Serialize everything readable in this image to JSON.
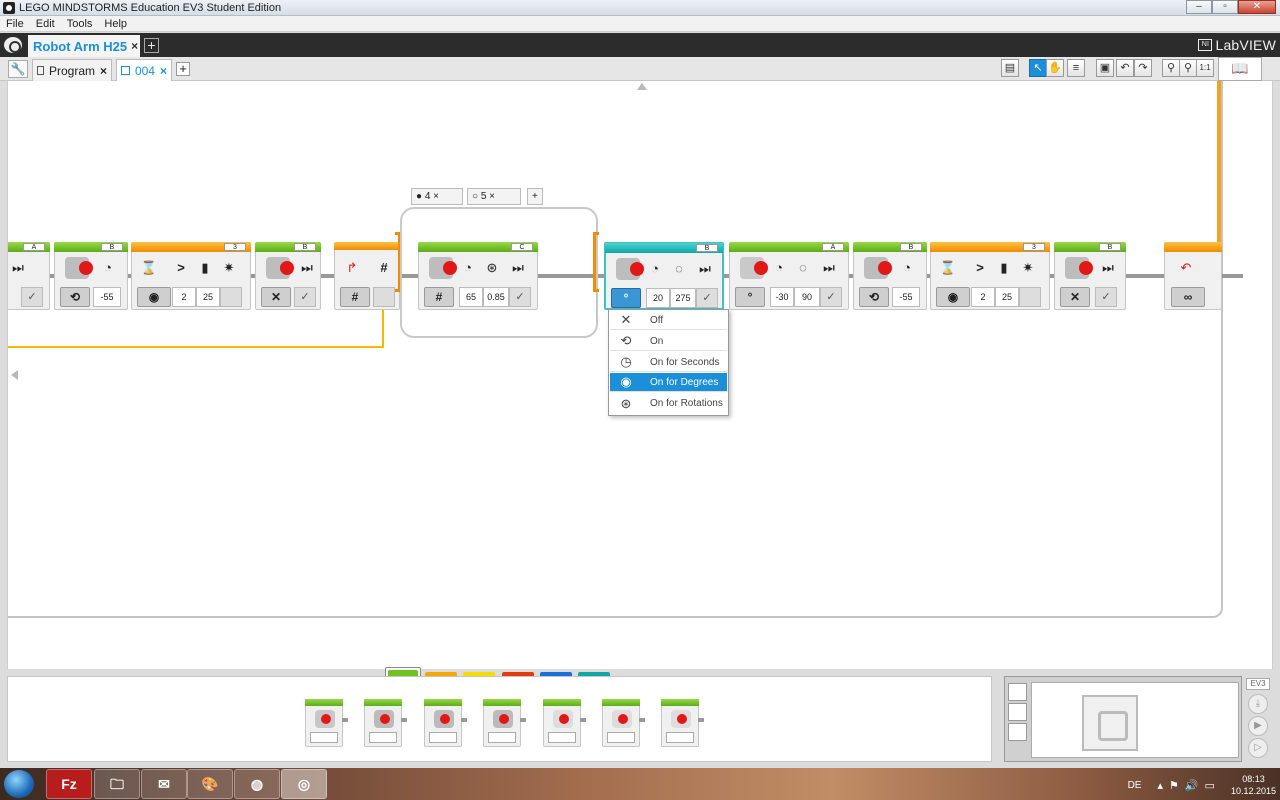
{
  "window": {
    "title": "LEGO MINDSTORMS Education EV3 Student Edition",
    "controls": [
      "–",
      "▫",
      "✕"
    ]
  },
  "menu": [
    "File",
    "Edit",
    "Tools",
    "Help"
  ],
  "project": {
    "name": "Robot Arm H25",
    "close": "×",
    "add": "+",
    "brand": "LabVIEW"
  },
  "program_tabs": [
    {
      "label": "Program",
      "close": "×"
    },
    {
      "label": "004",
      "close": "×"
    }
  ],
  "program_tabs_add": "+",
  "toolbar": {
    "zoom_reset": "1:1"
  },
  "canvas": {
    "blocks": [
      {
        "port": "A"
      },
      {
        "port": "B",
        "value": "-55"
      },
      {
        "port": "3",
        "values": [
          "2",
          "25"
        ],
        "compare": ">"
      },
      {
        "port": "B"
      },
      {
        "hash": "#"
      },
      {
        "port": "C",
        "values": [
          "65",
          "0.85"
        ]
      },
      {
        "port": "B",
        "values": [
          "20",
          "275"
        ]
      },
      {
        "port": "A",
        "values": [
          "-30",
          "90"
        ]
      },
      {
        "port": "B",
        "value": "-55"
      },
      {
        "port": "3",
        "values": [
          "2",
          "25"
        ],
        "compare": ">"
      },
      {
        "port": "B"
      },
      {
        "loop_end": "∞"
      }
    ],
    "switch_cases": [
      {
        "label": "4",
        "close": "×"
      },
      {
        "label": "5",
        "close": "×"
      }
    ],
    "switch_add": "+"
  },
  "mode_menu": {
    "items": [
      {
        "label": "Off",
        "icon": "x-icon"
      },
      {
        "label": "On",
        "icon": "rotate-icon"
      },
      {
        "label": "On for Seconds",
        "icon": "clock-icon"
      },
      {
        "label": "On for Degrees",
        "icon": "degrees-icon",
        "selected": true
      },
      {
        "label": "On for Rotations",
        "icon": "rotations-icon"
      }
    ]
  },
  "palette_tabs_colors": [
    "#6ec31f",
    "#f5a800",
    "#f5dc00",
    "#e23b12",
    "#1b6fd8",
    "#12a7a7"
  ],
  "hardware": {
    "ev3_label": "EV3"
  },
  "taskbar": {
    "language": "DE",
    "time": "08:13",
    "date": "10.12.2015"
  }
}
